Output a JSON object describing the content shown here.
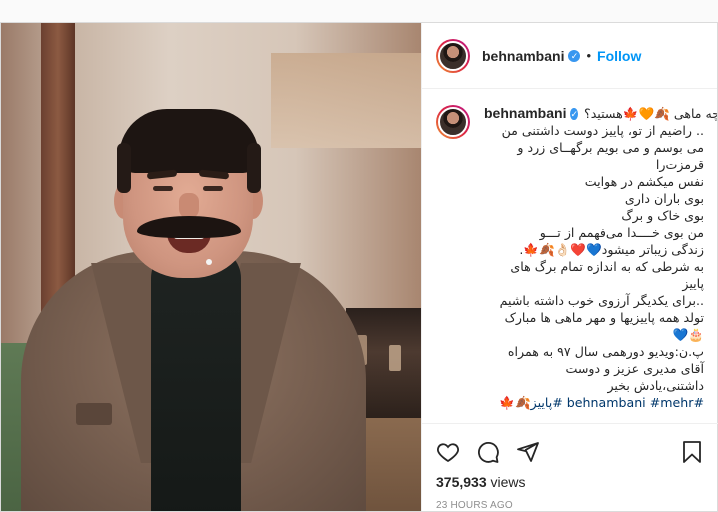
{
  "header": {
    "username": "behnambani",
    "follow_label": "Follow",
    "separator": "•"
  },
  "caption": {
    "username": "behnambani",
    "first_line": "متولد چه ماهی 🍂🧡🍁هستید؟",
    "lines": [
      ".. راضیم از تو، پاییز دوست داشتنی من",
      "می بوسم و می بویم برگهــای زرد و",
      "قرمزت‌را",
      "نفس میکشم در هوایت",
      "بوی باران داری",
      "بوی خاک و برگ",
      "من بوی خــــدا می‌فهمم از تـــو",
      "زندگی زیباتر میشود💙❤️👌🏻🍂🍁.",
      "به شرطی که به اندازه تمام برگ های",
      "پاییز",
      "..برای یکدیگر آرزوی خوب داشته باشیم",
      "تولد همه پاییزیها و مهر ماهی ها مبارک",
      "🎂💙",
      "پ.ن:ویدیو دورهمی سال ۹۷ به همراه",
      "آقای مدیری عزیز و دوست",
      "داشتنی،یادش بخیر"
    ],
    "tags": [
      "#behnambani",
      "#mehr",
      "#پاییز🍂🍁"
    ]
  },
  "footer": {
    "views_count": "375,933",
    "views_label": "views",
    "timestamp": "23 HOURS AGO"
  },
  "icons": {
    "like": "heart-icon",
    "comment": "comment-icon",
    "share": "share-icon",
    "save": "bookmark-icon",
    "verified": "verified-badge-icon"
  },
  "colors": {
    "follow_blue": "#0095f6",
    "verified_blue": "#3897f0",
    "hashtag": "#00376b",
    "timestamp_gray": "#8e8e8e"
  }
}
